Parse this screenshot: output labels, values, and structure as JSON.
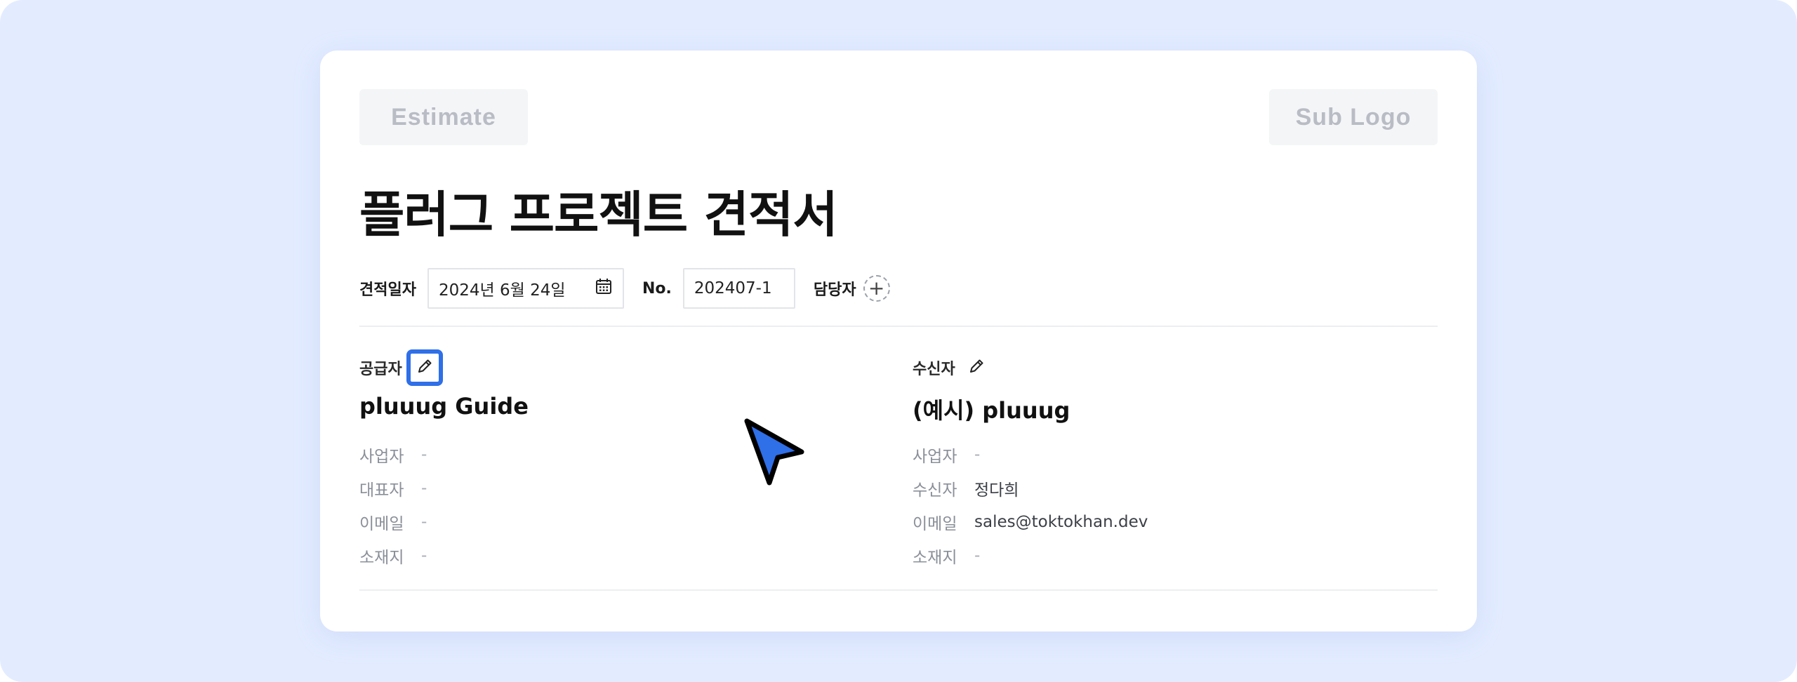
{
  "header": {
    "logo_left": "Estimate",
    "logo_right": "Sub Logo",
    "title": "플러그 프로젝트 견적서"
  },
  "meta": {
    "date_label": "견적일자",
    "date_value": "2024년 6월 24일",
    "no_label": "No.",
    "no_value": "202407-1",
    "manager_label": "담당자",
    "add_symbol": "+"
  },
  "supplier": {
    "label": "공급자",
    "name": "pluuug Guide",
    "rows": [
      {
        "label": "사업자",
        "value": "-"
      },
      {
        "label": "대표자",
        "value": "-"
      },
      {
        "label": "이메일",
        "value": "-"
      },
      {
        "label": "소재지",
        "value": "-"
      }
    ]
  },
  "recipient": {
    "label": "수신자",
    "name": "(예시) pluuug",
    "rows": [
      {
        "label": "사업자",
        "value": "-"
      },
      {
        "label": "수신자",
        "value": "정다희"
      },
      {
        "label": "이메일",
        "value": "sales@toktokhan.dev"
      },
      {
        "label": "소재지",
        "value": "-"
      }
    ]
  },
  "icons": {
    "calendar": "calendar-icon",
    "edit": "pencil-icon",
    "add": "plus-icon",
    "cursor": "mouse-cursor"
  },
  "colors": {
    "background": "#e3ecff",
    "highlight": "#2f6fe8",
    "cursor_fill": "#2f6fe8"
  }
}
